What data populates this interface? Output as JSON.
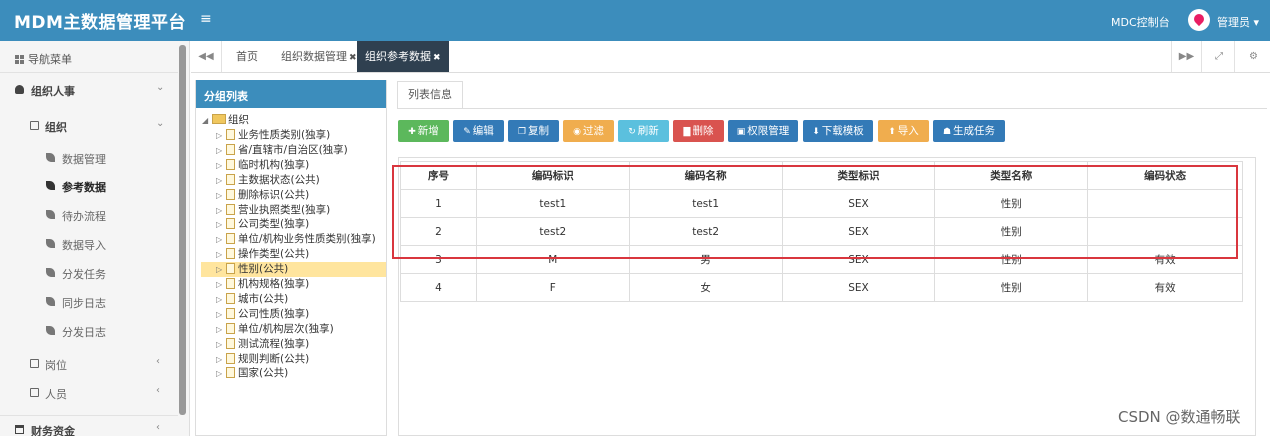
{
  "header": {
    "title": "MDM主数据管理平台",
    "menu_icon": "≡",
    "mdc": "MDC控制台",
    "user": "管理员 ▾"
  },
  "sidebar": {
    "nav_title": "导航菜单",
    "group1": "组织人事",
    "group1_sub": "组织",
    "items": [
      "数据管理",
      "参考数据",
      "待办流程",
      "数据导入",
      "分发任务",
      "同步日志",
      "分发日志"
    ],
    "positions": "岗位",
    "people": "人员",
    "finance": "财务资金"
  },
  "tabs": {
    "home": "首页",
    "tab1": "组织数据管理",
    "tab2": "组织参考数据"
  },
  "tree": {
    "title": "分组列表",
    "root": "组织",
    "nodes": [
      "业务性质类别(独享)",
      "省/直辖市/自治区(独享)",
      "临时机构(独享)",
      "主数据状态(公共)",
      "删除标识(公共)",
      "营业执照类型(独享)",
      "公司类型(独享)",
      "单位/机构业务性质类别(独享)",
      "操作类型(公共)",
      "性别(公共)",
      "机构规格(独享)",
      "城市(公共)",
      "公司性质(独享)",
      "单位/机构层次(独享)",
      "测试流程(独享)",
      "规则判断(公共)",
      "国家(公共)"
    ]
  },
  "content": {
    "tab": "列表信息",
    "buttons": [
      "新增",
      "编辑",
      "复制",
      "过滤",
      "刷新",
      "删除",
      "权限管理",
      "下载模板",
      "导入",
      "生成任务"
    ],
    "columns": [
      "序号",
      "编码标识",
      "编码名称",
      "类型标识",
      "类型名称",
      "编码状态"
    ],
    "rows": [
      [
        "1",
        "test1",
        "test1",
        "SEX",
        "性别",
        ""
      ],
      [
        "2",
        "test2",
        "test2",
        "SEX",
        "性别",
        ""
      ],
      [
        "3",
        "M",
        "男",
        "SEX",
        "性别",
        "有效"
      ],
      [
        "4",
        "F",
        "女",
        "SEX",
        "性别",
        "有效"
      ]
    ]
  },
  "watermark": "CSDN @数通畅联",
  "colors": {
    "header": "#3c8dbc",
    "active_tab": "#2f4050",
    "highlight_box": "#d9363e"
  }
}
